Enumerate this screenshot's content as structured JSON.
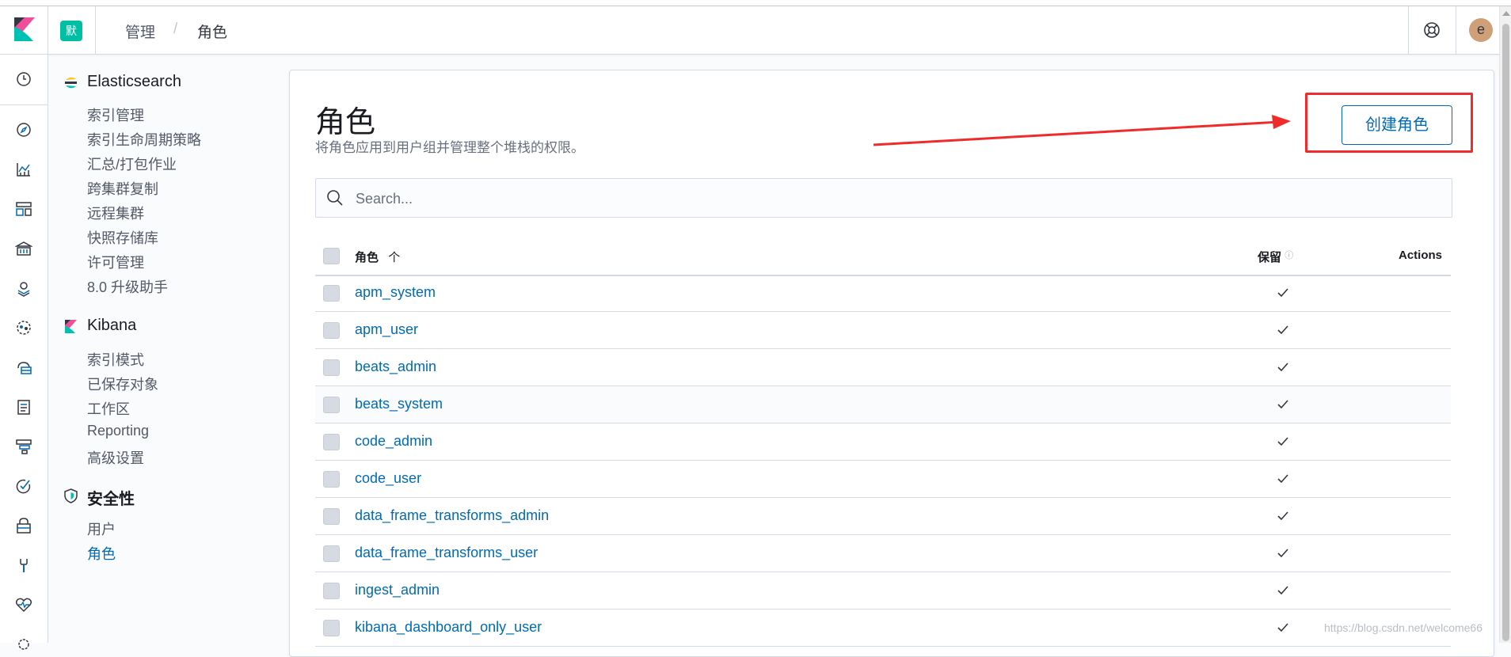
{
  "header": {
    "space_initial": "默",
    "breadcrumbs": [
      "管理",
      "/",
      "角色"
    ],
    "avatar_initial": "e"
  },
  "rail_icons": [
    "clock-icon",
    "compass-icon",
    "visualize-icon",
    "dashboard-icon",
    "canvas-icon",
    "maps-icon",
    "ml-icon",
    "infrastructure-icon",
    "logs-icon",
    "apm-icon",
    "uptime-icon",
    "siem-icon",
    "devtools-icon",
    "monitoring-icon",
    "management-icon"
  ],
  "sidenav": {
    "elasticsearch": {
      "title": "Elasticsearch",
      "items": [
        "索引管理",
        "索引生命周期策略",
        "汇总/打包作业",
        "跨集群复制",
        "远程集群",
        "快照存储库",
        "许可管理",
        "8.0 升级助手"
      ]
    },
    "kibana": {
      "title": "Kibana",
      "items": [
        "索引模式",
        "已保存对象",
        "工作区",
        "Reporting",
        "高级设置"
      ]
    },
    "security": {
      "title": "安全性",
      "items": [
        "用户",
        "角色"
      ],
      "active": "角色"
    }
  },
  "main": {
    "title": "角色",
    "description": "将角色应用到用户组并管理整个堆栈的权限。",
    "create_button": "创建角色",
    "search_placeholder": "Search...",
    "columns": {
      "role": "角色",
      "sort_indicator": "个",
      "reserved": "保留",
      "actions": "Actions"
    },
    "roles": [
      {
        "name": "apm_system",
        "reserved": true
      },
      {
        "name": "apm_user",
        "reserved": true
      },
      {
        "name": "beats_admin",
        "reserved": true
      },
      {
        "name": "beats_system",
        "reserved": true
      },
      {
        "name": "code_admin",
        "reserved": true
      },
      {
        "name": "code_user",
        "reserved": true
      },
      {
        "name": "data_frame_transforms_admin",
        "reserved": true
      },
      {
        "name": "data_frame_transforms_user",
        "reserved": true
      },
      {
        "name": "ingest_admin",
        "reserved": true
      },
      {
        "name": "kibana_dashboard_only_user",
        "reserved": true
      }
    ]
  },
  "watermark": "https://blog.csdn.net/welcome66",
  "colors": {
    "accent": "#006bb4",
    "annotation": "#f02b2b",
    "brand_teal": "#00bfa5"
  }
}
